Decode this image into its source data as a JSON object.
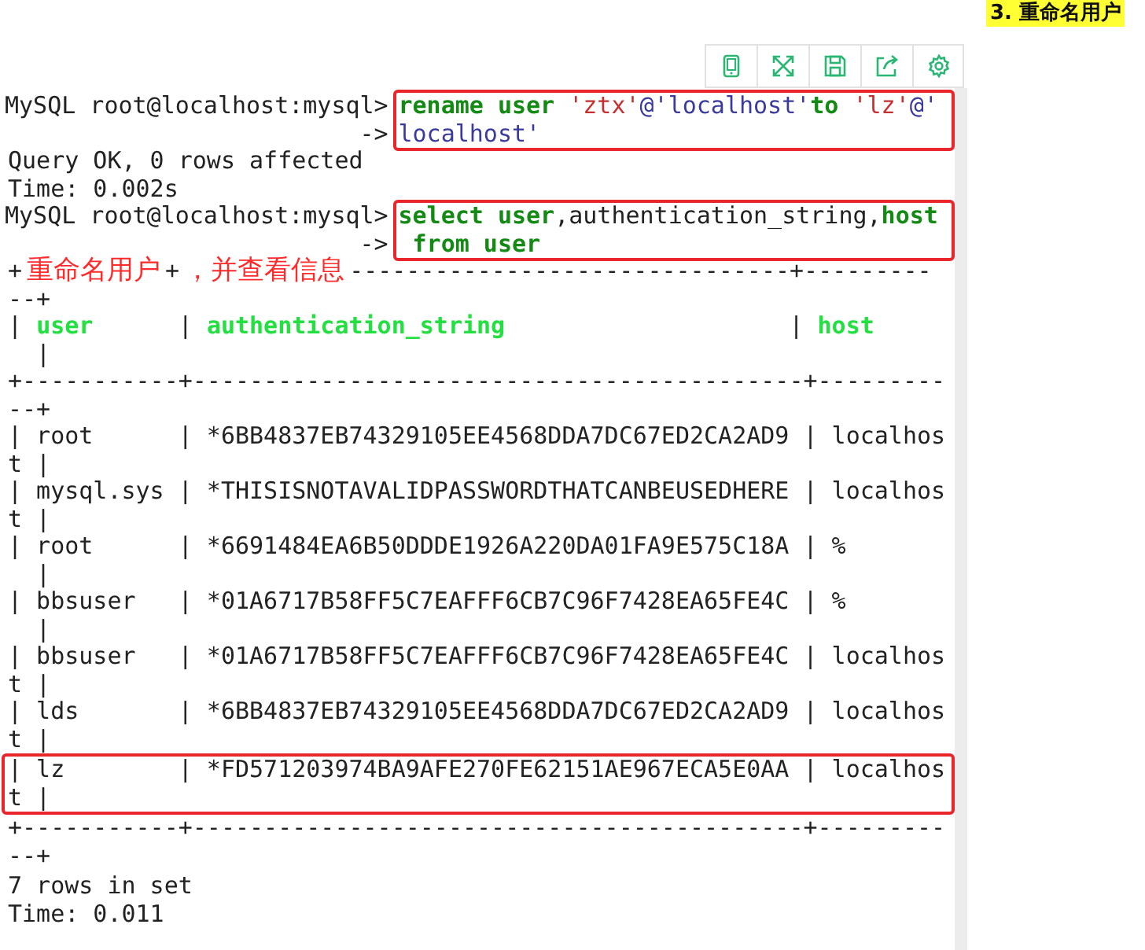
{
  "heading": "3. 重命名用户",
  "terminal": {
    "blocks": [
      {
        "kind": "command",
        "prompt": "MySQL root@localhost:mysql>",
        "continuation": "->",
        "highlighted": true,
        "lines": [
          [
            {
              "text": "rename user ",
              "kind": "keyword"
            },
            {
              "text": "'ztx'",
              "kind": "string"
            },
            {
              "text": "@'localhost'",
              "kind": "name"
            },
            {
              "text": "to",
              "kind": "keyword"
            },
            {
              "text": " 'lz'",
              "kind": "string"
            },
            {
              "text": "@'",
              "kind": "name"
            }
          ],
          [
            {
              "text": "localhost'",
              "kind": "name"
            }
          ]
        ]
      },
      {
        "kind": "output",
        "highlighted": false,
        "lines": [
          "Query OK, 0 rows affected",
          "Time: 0.002s"
        ]
      },
      {
        "kind": "command",
        "prompt": "MySQL root@localhost:mysql>",
        "continuation": "->",
        "highlighted": true,
        "lines": [
          [
            {
              "text": "select user",
              "kind": "keyword"
            },
            {
              "text": ",authentication_string,",
              "kind": "plain"
            },
            {
              "text": "host",
              "kind": "keyword"
            }
          ],
          [
            {
              "text": " from user",
              "kind": "keyword"
            }
          ]
        ]
      },
      {
        "kind": "output",
        "highlighted": false,
        "lines": [
          [
            {
              "text": "+",
              "kind": "plain"
            },
            {
              "text": "重命名用户",
              "kind": "note"
            },
            {
              "text": "+",
              "kind": "plain"
            },
            {
              "text": "，并查看信息",
              "kind": "note"
            },
            {
              "text": "-------------------------------+---------",
              "kind": "plain"
            }
          ],
          "--+",
          [
            {
              "text": "| ",
              "kind": "plain"
            },
            {
              "text": "user",
              "kind": "header"
            },
            {
              "text": "      | ",
              "kind": "plain"
            },
            {
              "text": "authentication_string",
              "kind": "header"
            },
            {
              "text": "                    | ",
              "kind": "plain"
            },
            {
              "text": "host",
              "kind": "header"
            }
          ],
          "  |",
          "+-----------+-------------------------------------------+---------",
          "--+",
          "| root      | *6BB4837EB74329105EE4568DDA7DC67ED2CA2AD9 | localhos",
          "t |",
          "| mysql.sys | *THISISNOTAVALIDPASSWORDTHATCANBEUSEDHERE | localhos",
          "t |",
          "| root      | *6691484EA6B50DDDE1926A220DA01FA9E575C18A | %",
          "  |",
          "| bbsuser   | *01A6717B58FF5C7EAFFF6CB7C96F7428EA65FE4C | %",
          "  |",
          "| bbsuser   | *01A6717B58FF5C7EAFFF6CB7C96F7428EA65FE4C | localhos",
          "t |",
          "| lds       | *6BB4837EB74329105EE4568DDA7DC67ED2CA2AD9 | localhos",
          "t |"
        ]
      },
      {
        "kind": "output",
        "highlighted": true,
        "lines": [
          "| lz        | *FD571203974BA9AFE270FE62151AE967ECA5E0AA | localhos",
          "t |"
        ]
      },
      {
        "kind": "output",
        "highlighted": false,
        "lines": [
          "+-----------+-------------------------------------------+---------",
          "--+"
        ]
      },
      {
        "kind": "summary",
        "highlighted": false,
        "lines": [
          "7 rows in set",
          "Time: 0.011"
        ]
      }
    ]
  }
}
